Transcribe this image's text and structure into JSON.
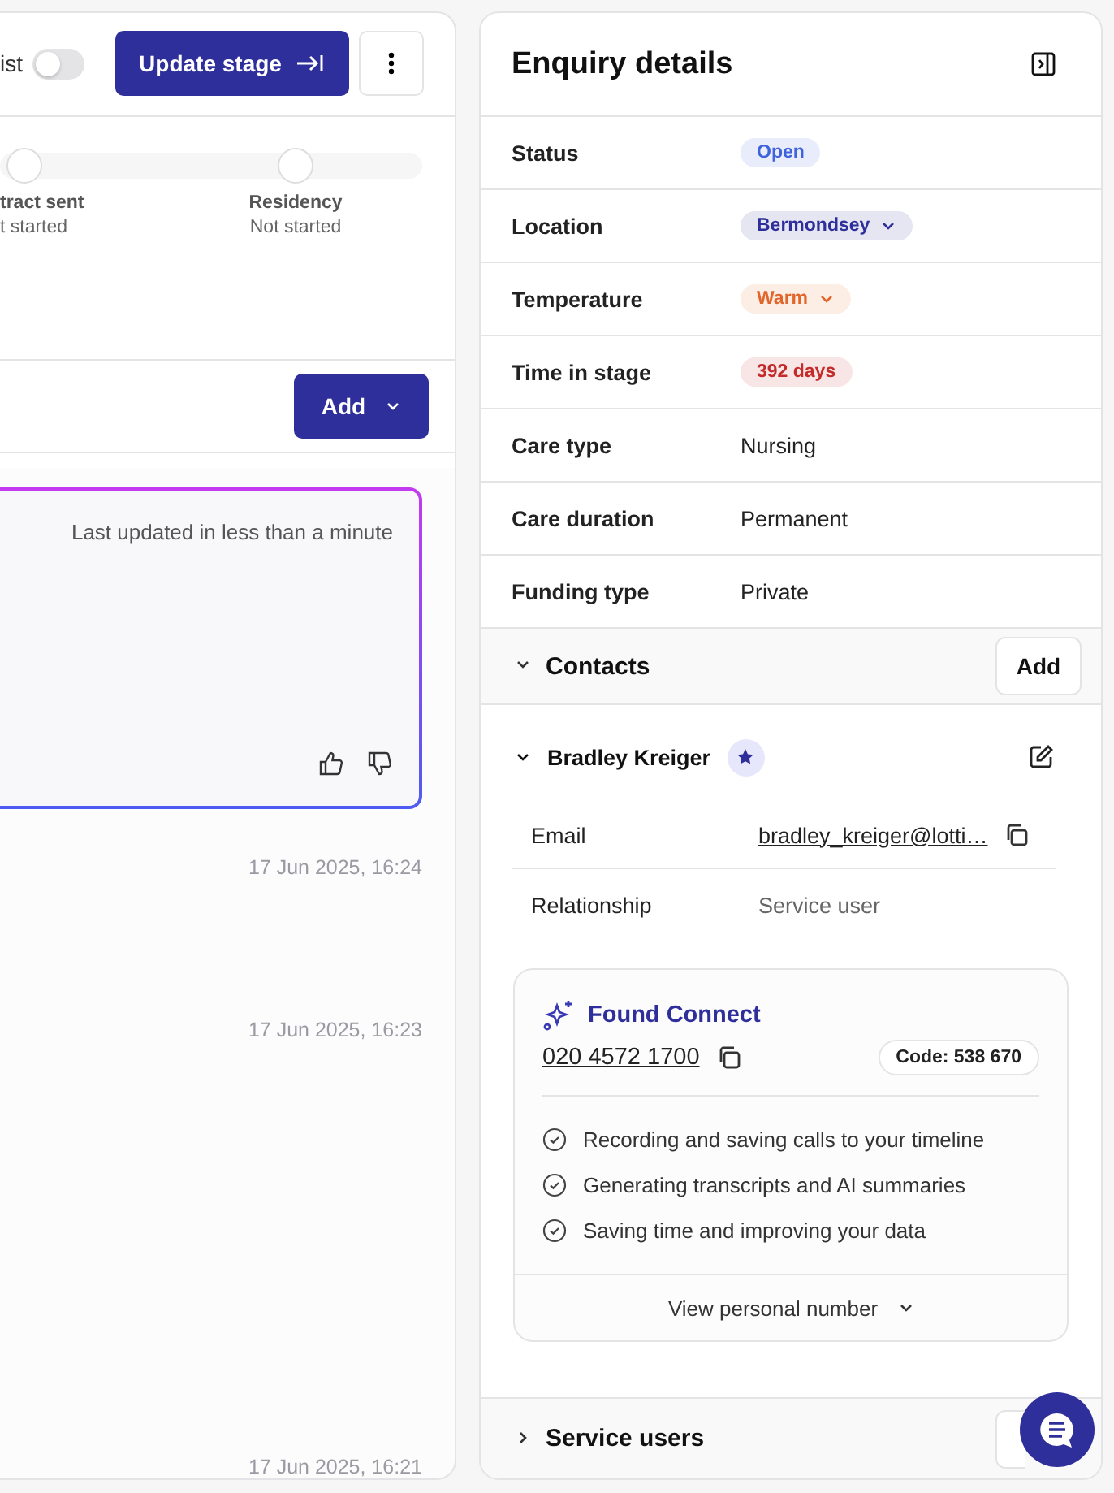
{
  "workflow": {
    "toggle": {
      "label": "ist",
      "on": false
    },
    "update_button": "Update stage",
    "stages": [
      {
        "name": "tract sent",
        "status": "t started"
      },
      {
        "name": "Residency",
        "status": "Not started"
      }
    ],
    "add_button": "Add"
  },
  "summary_card": {
    "updated": "Last updated in less than a minute"
  },
  "timeline": [
    {
      "time": "17 Jun 2025, 16:24"
    },
    {
      "time": "17 Jun 2025, 16:23"
    },
    {
      "time": "17 Jun 2025, 16:21"
    }
  ],
  "details": {
    "title": "Enquiry details",
    "fields": [
      {
        "label": "Status",
        "value": "Open",
        "kind": "badge",
        "color": "#3e63dd",
        "dropdown": false
      },
      {
        "label": "Location",
        "value": "Bermondsey",
        "kind": "badge",
        "color": "#2f2f9b",
        "dropdown": true
      },
      {
        "label": "Temperature",
        "value": "Warm",
        "kind": "badge",
        "color": "#e2652a",
        "dropdown": true
      },
      {
        "label": "Time in stage",
        "value": "392 days",
        "kind": "badge",
        "color": "#c42a2a",
        "dropdown": false
      },
      {
        "label": "Care type",
        "value": "Nursing",
        "kind": "text"
      },
      {
        "label": "Care duration",
        "value": "Permanent",
        "kind": "text"
      },
      {
        "label": "Funding type",
        "value": "Private",
        "kind": "text"
      }
    ]
  },
  "contacts": {
    "title": "Contacts",
    "expanded": true,
    "add_button": "Add",
    "people": [
      {
        "name": "Bradley Kreiger",
        "expanded": true,
        "primary": true,
        "fields": [
          {
            "label": "Email",
            "value": "bradley_kreiger@lotti…",
            "kind": "link"
          },
          {
            "label": "Relationship",
            "value": "Service user",
            "kind": "text"
          }
        ]
      }
    ]
  },
  "connect": {
    "title": "Found Connect",
    "phone": "020 4572 1700",
    "code": "Code: 538 670",
    "features": [
      "Recording and saving calls to your timeline",
      "Generating transcripts and AI summaries",
      "Saving time and improving your data"
    ],
    "toggle": "View personal number"
  },
  "service_users": {
    "title": "Service users",
    "expanded": false
  }
}
